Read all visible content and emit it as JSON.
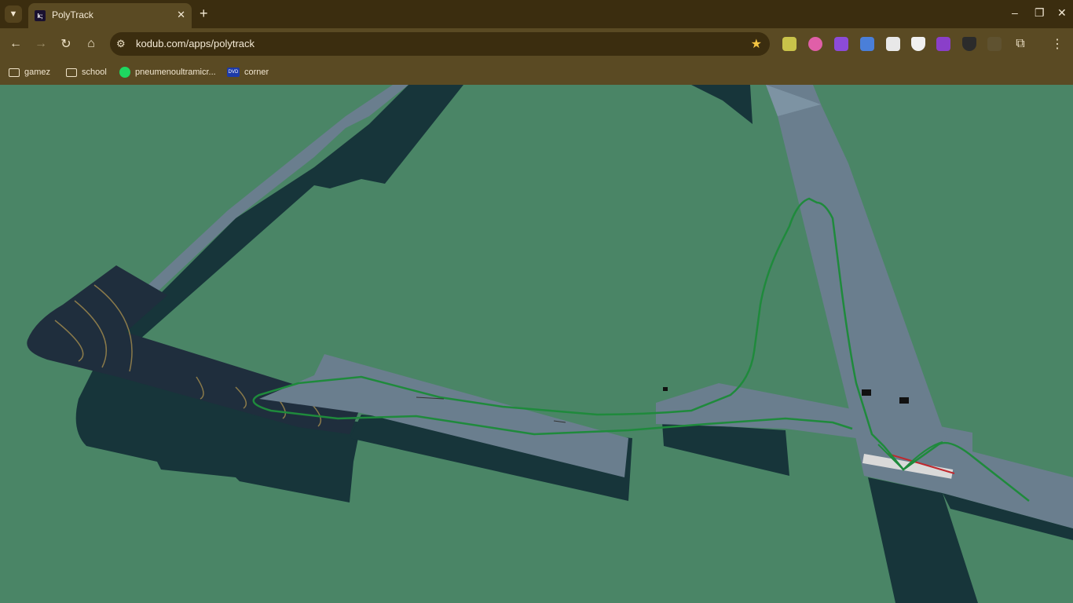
{
  "tabbar": {
    "tab_list_icon": "chevron-down-icon",
    "tab": {
      "title": "PolyTrack",
      "favicon_text": "k;",
      "close_glyph": "✕"
    },
    "new_tab_glyph": "+",
    "window_controls": {
      "minimize": "–",
      "restore": "❐",
      "close": "✕"
    }
  },
  "toolbar": {
    "back_glyph": "←",
    "forward_glyph": "→",
    "reload_glyph": "↻",
    "home_glyph": "⌂",
    "site_info_glyph": "⚙",
    "url": "kodub.com/apps/polytrack",
    "bookmark_star": "★",
    "menu_glyph": "⋮",
    "extensions_glyph": "⧉"
  },
  "bookmarks": {
    "items": [
      {
        "label": "gamez",
        "icon": "folder-icon"
      },
      {
        "label": "school",
        "icon": "folder-icon"
      },
      {
        "label": "pneumenoultramicr...",
        "icon": "spotify-icon"
      },
      {
        "label": "corner",
        "icon": "dvd-icon"
      }
    ]
  },
  "game": {
    "background_color": "#4a8566",
    "track_color": "#6a7e8e",
    "shadow_color": "#17353a",
    "path_color": "#1f8a3c"
  }
}
